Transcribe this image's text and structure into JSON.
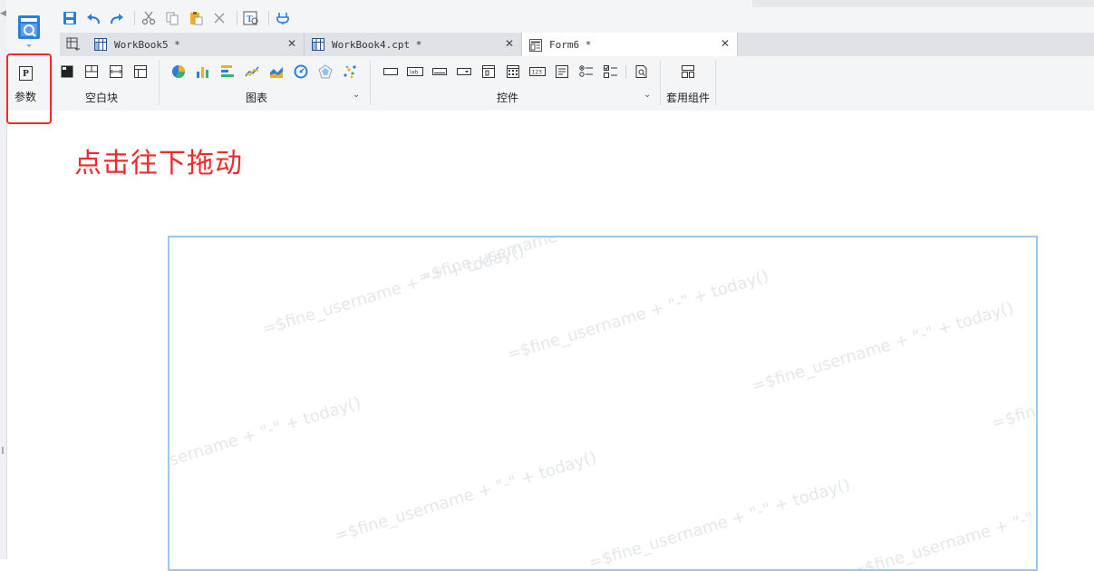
{
  "app": {
    "logo_icon": "report-designer-icon"
  },
  "quick_access": [
    {
      "name": "save-icon"
    },
    {
      "name": "undo-icon"
    },
    {
      "name": "redo-icon"
    },
    {
      "name": "cut-icon"
    },
    {
      "name": "copy-icon"
    },
    {
      "name": "paste-icon"
    },
    {
      "name": "delete-icon"
    },
    {
      "name": "text-preview-icon"
    },
    {
      "name": "plugin-icon"
    }
  ],
  "tabs": [
    {
      "label": "WorkBook5 *",
      "icon": "workbook-icon",
      "active": false
    },
    {
      "label": "WorkBook4.cpt *",
      "icon": "workbook-icon",
      "active": false
    },
    {
      "label": "Form6 *",
      "icon": "form-icon",
      "active": true
    }
  ],
  "ribbon": {
    "param": {
      "label": "参数",
      "icon_letter": "P"
    },
    "groups": [
      {
        "label": "空白块",
        "icons": [
          "chart-block-icon",
          "absolute-block-icon",
          "tab-block-icon",
          "frozen-block-icon"
        ]
      },
      {
        "label": "图表",
        "icons": [
          "pie-chart-icon",
          "bar-chart-icon",
          "hbar-chart-icon",
          "line-chart-icon",
          "area-chart-icon",
          "gauge-chart-icon",
          "radar-chart-icon",
          "scatter-chart-icon"
        ]
      },
      {
        "label": "控件",
        "icons": [
          "label-control-icon",
          "text-control-icon",
          "button-control-icon",
          "combo-control-icon",
          "date-control-icon",
          "calendar-control-icon",
          "number-control-icon",
          "textarea-control-icon",
          "radio-group-icon",
          "checkbox-group-icon",
          "search-control-icon"
        ]
      },
      {
        "label": "套用组件",
        "icons": [
          "template-component-icon"
        ]
      }
    ]
  },
  "annotation": "点击往下拖动",
  "watermark": "=$fine_username + \"-\" + today()",
  "colors": {
    "highlight": "#f02a2a",
    "accent": "#2b7de0",
    "canvas_border": "#9cc8ee"
  }
}
